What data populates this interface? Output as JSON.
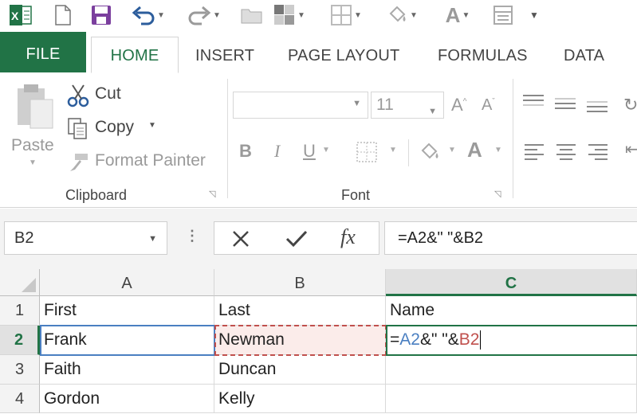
{
  "qat": {
    "icons": [
      "excel-logo-icon",
      "new-document-icon",
      "save-icon",
      "undo-icon",
      "redo-icon",
      "open-icon",
      "borders-icon",
      "format-icon",
      "fill-color-icon",
      "font-color-icon",
      "form-icon",
      "customize-icon"
    ]
  },
  "tabs": [
    "FILE",
    "HOME",
    "INSERT",
    "PAGE LAYOUT",
    "FORMULAS",
    "DATA"
  ],
  "ribbon": {
    "clipboard": {
      "paste": "Paste",
      "cut": "Cut",
      "copy": "Copy",
      "format_painter": "Format Painter",
      "group": "Clipboard"
    },
    "font": {
      "name": "",
      "size": "11",
      "bold": "B",
      "italic": "I",
      "underline": "U",
      "font_color": "A",
      "grow": "A",
      "shrink": "A",
      "group": "Font"
    }
  },
  "formula_bar": {
    "name_box": "B2",
    "fx": "fx",
    "formula": "=A2&\" \"&B2"
  },
  "grid": {
    "columns": [
      "A",
      "B",
      "C"
    ],
    "active_column": "C",
    "rows": [
      {
        "num": "1",
        "a": "First",
        "b": "Last",
        "c": "Name"
      },
      {
        "num": "2",
        "a": "Frank",
        "b": "Newman",
        "c": ""
      },
      {
        "num": "3",
        "a": "Faith",
        "b": "Duncan",
        "c": ""
      },
      {
        "num": "4",
        "a": "Gordon",
        "b": "Kelly",
        "c": ""
      }
    ],
    "edit": {
      "eq": "=",
      "ref1": "A2",
      "mid": "&\" \"&",
      "ref2": "B2"
    }
  },
  "colors": {
    "accent": "#217346",
    "ref1": "#4a7fc1",
    "ref2": "#c0504d"
  }
}
